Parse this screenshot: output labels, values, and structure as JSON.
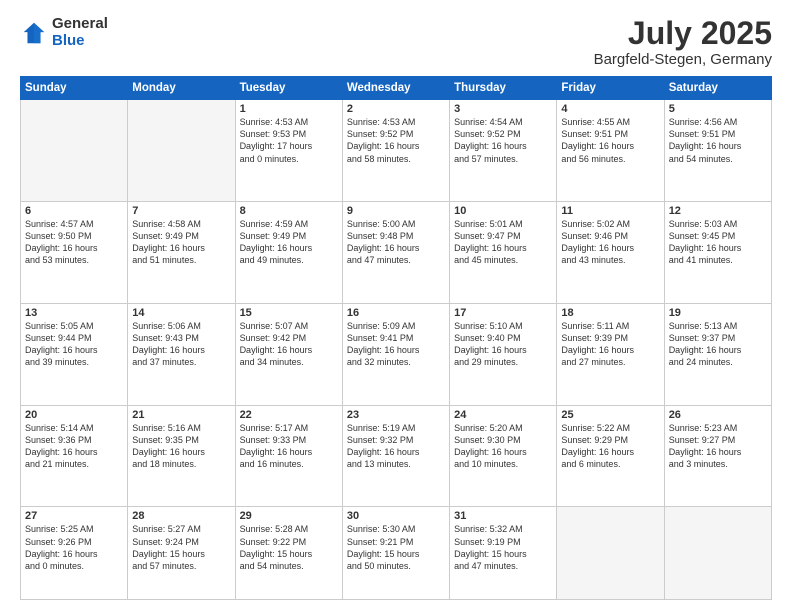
{
  "logo": {
    "general": "General",
    "blue": "Blue"
  },
  "header": {
    "month": "July 2025",
    "location": "Bargfeld-Stegen, Germany"
  },
  "days_of_week": [
    "Sunday",
    "Monday",
    "Tuesday",
    "Wednesday",
    "Thursday",
    "Friday",
    "Saturday"
  ],
  "weeks": [
    [
      {
        "day": "",
        "text": ""
      },
      {
        "day": "",
        "text": ""
      },
      {
        "day": "1",
        "text": "Sunrise: 4:53 AM\nSunset: 9:53 PM\nDaylight: 17 hours\nand 0 minutes."
      },
      {
        "day": "2",
        "text": "Sunrise: 4:53 AM\nSunset: 9:52 PM\nDaylight: 16 hours\nand 58 minutes."
      },
      {
        "day": "3",
        "text": "Sunrise: 4:54 AM\nSunset: 9:52 PM\nDaylight: 16 hours\nand 57 minutes."
      },
      {
        "day": "4",
        "text": "Sunrise: 4:55 AM\nSunset: 9:51 PM\nDaylight: 16 hours\nand 56 minutes."
      },
      {
        "day": "5",
        "text": "Sunrise: 4:56 AM\nSunset: 9:51 PM\nDaylight: 16 hours\nand 54 minutes."
      }
    ],
    [
      {
        "day": "6",
        "text": "Sunrise: 4:57 AM\nSunset: 9:50 PM\nDaylight: 16 hours\nand 53 minutes."
      },
      {
        "day": "7",
        "text": "Sunrise: 4:58 AM\nSunset: 9:49 PM\nDaylight: 16 hours\nand 51 minutes."
      },
      {
        "day": "8",
        "text": "Sunrise: 4:59 AM\nSunset: 9:49 PM\nDaylight: 16 hours\nand 49 minutes."
      },
      {
        "day": "9",
        "text": "Sunrise: 5:00 AM\nSunset: 9:48 PM\nDaylight: 16 hours\nand 47 minutes."
      },
      {
        "day": "10",
        "text": "Sunrise: 5:01 AM\nSunset: 9:47 PM\nDaylight: 16 hours\nand 45 minutes."
      },
      {
        "day": "11",
        "text": "Sunrise: 5:02 AM\nSunset: 9:46 PM\nDaylight: 16 hours\nand 43 minutes."
      },
      {
        "day": "12",
        "text": "Sunrise: 5:03 AM\nSunset: 9:45 PM\nDaylight: 16 hours\nand 41 minutes."
      }
    ],
    [
      {
        "day": "13",
        "text": "Sunrise: 5:05 AM\nSunset: 9:44 PM\nDaylight: 16 hours\nand 39 minutes."
      },
      {
        "day": "14",
        "text": "Sunrise: 5:06 AM\nSunset: 9:43 PM\nDaylight: 16 hours\nand 37 minutes."
      },
      {
        "day": "15",
        "text": "Sunrise: 5:07 AM\nSunset: 9:42 PM\nDaylight: 16 hours\nand 34 minutes."
      },
      {
        "day": "16",
        "text": "Sunrise: 5:09 AM\nSunset: 9:41 PM\nDaylight: 16 hours\nand 32 minutes."
      },
      {
        "day": "17",
        "text": "Sunrise: 5:10 AM\nSunset: 9:40 PM\nDaylight: 16 hours\nand 29 minutes."
      },
      {
        "day": "18",
        "text": "Sunrise: 5:11 AM\nSunset: 9:39 PM\nDaylight: 16 hours\nand 27 minutes."
      },
      {
        "day": "19",
        "text": "Sunrise: 5:13 AM\nSunset: 9:37 PM\nDaylight: 16 hours\nand 24 minutes."
      }
    ],
    [
      {
        "day": "20",
        "text": "Sunrise: 5:14 AM\nSunset: 9:36 PM\nDaylight: 16 hours\nand 21 minutes."
      },
      {
        "day": "21",
        "text": "Sunrise: 5:16 AM\nSunset: 9:35 PM\nDaylight: 16 hours\nand 18 minutes."
      },
      {
        "day": "22",
        "text": "Sunrise: 5:17 AM\nSunset: 9:33 PM\nDaylight: 16 hours\nand 16 minutes."
      },
      {
        "day": "23",
        "text": "Sunrise: 5:19 AM\nSunset: 9:32 PM\nDaylight: 16 hours\nand 13 minutes."
      },
      {
        "day": "24",
        "text": "Sunrise: 5:20 AM\nSunset: 9:30 PM\nDaylight: 16 hours\nand 10 minutes."
      },
      {
        "day": "25",
        "text": "Sunrise: 5:22 AM\nSunset: 9:29 PM\nDaylight: 16 hours\nand 6 minutes."
      },
      {
        "day": "26",
        "text": "Sunrise: 5:23 AM\nSunset: 9:27 PM\nDaylight: 16 hours\nand 3 minutes."
      }
    ],
    [
      {
        "day": "27",
        "text": "Sunrise: 5:25 AM\nSunset: 9:26 PM\nDaylight: 16 hours\nand 0 minutes."
      },
      {
        "day": "28",
        "text": "Sunrise: 5:27 AM\nSunset: 9:24 PM\nDaylight: 15 hours\nand 57 minutes."
      },
      {
        "day": "29",
        "text": "Sunrise: 5:28 AM\nSunset: 9:22 PM\nDaylight: 15 hours\nand 54 minutes."
      },
      {
        "day": "30",
        "text": "Sunrise: 5:30 AM\nSunset: 9:21 PM\nDaylight: 15 hours\nand 50 minutes."
      },
      {
        "day": "31",
        "text": "Sunrise: 5:32 AM\nSunset: 9:19 PM\nDaylight: 15 hours\nand 47 minutes."
      },
      {
        "day": "",
        "text": ""
      },
      {
        "day": "",
        "text": ""
      }
    ]
  ]
}
